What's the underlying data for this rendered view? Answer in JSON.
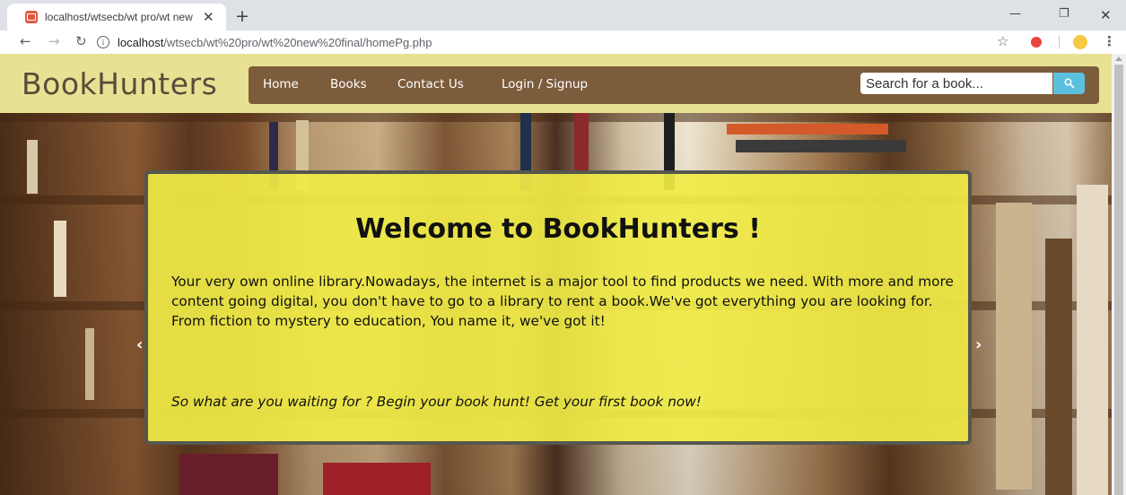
{
  "browser": {
    "tab_title": "localhost/wtsecb/wt pro/wt new",
    "tab_close": "✕",
    "new_tab": "+",
    "url_host": "localhost",
    "url_path": "/wtsecb/wt%20pro/wt%20new%20final/homePg.php",
    "icons": [
      "back-icon",
      "forward-icon",
      "reload-icon",
      "info-icon",
      "star-icon",
      "shield-extension-icon",
      "avatar-extension-icon",
      "menu-icon"
    ]
  },
  "site": {
    "brand": "BookHunters",
    "nav": {
      "home": "Home",
      "books": "Books",
      "contact": "Contact Us",
      "login": "Login / Signup"
    },
    "search": {
      "placeholder": "Search for a book...",
      "button_icon": "search-icon"
    },
    "colors": {
      "header_bg": "#e8e193",
      "navbar_bg": "#7d5c3c",
      "search_button": "#5bc0de",
      "welcome_bg": "#f0ec46"
    }
  },
  "hero": {
    "title": "Welcome to BookHunters !",
    "body": "Your very own online library.Nowadays, the internet is a major tool to find products we need. With more and more content going digital, you don't have to go to a library to rent a book.We've got everything you are looking for. From fiction to mystery to education, You name it, we've got it!",
    "cta": "So what are you waiting for ? Begin your book hunt! Get your first book now!",
    "prev_arrow": "‹",
    "next_arrow": "›"
  }
}
